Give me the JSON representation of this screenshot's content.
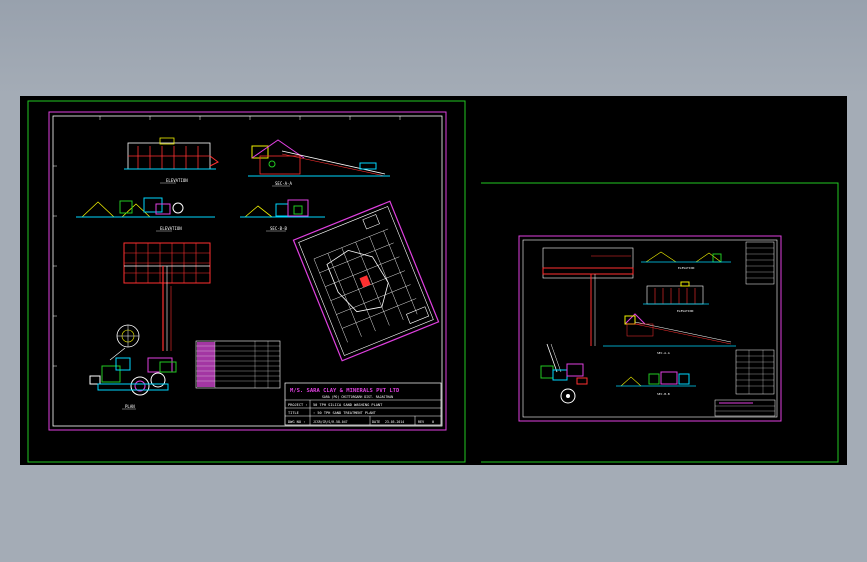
{
  "title_block": {
    "company": "M/S. SARA CLAY & MINERALS PVT LTD",
    "address": "SARA (PO) CHITTORGARH DIST. RAJASTHAN",
    "project_label": "PROJECT :",
    "project_value": "50 TPH SILICA SAND WASHING PLANT",
    "title_label": "TITLE",
    "title_value": ": 50 TPH SAND TREATMENT PLANT",
    "dwg_label": "DWG NO :",
    "dwg_value": "JCSR/CR/S/R-58-047",
    "date_label": "DATE",
    "date_value": "23-05-2014",
    "rev_label": "REV",
    "rev_value": "0"
  },
  "view_labels": {
    "elevation_1": "ELEVATION",
    "section_aa": "SEC-A-A",
    "elevation_2": "ELEVATION",
    "section_bb": "SEC-B-B",
    "plan": "PLAN",
    "r_elevation": "ELEVATION",
    "r_elevation_2": "ELEVATION",
    "r_section": "SEC-A-A",
    "r_section_2": "SEC-B-B"
  },
  "colors": {
    "viewport_border": "#22c822",
    "sheet_border": "#e040e0",
    "drawing_white": "#ffffff",
    "drawing_red": "#ff3030",
    "drawing_cyan": "#00d8ff",
    "drawing_yellow": "#f0f000"
  }
}
